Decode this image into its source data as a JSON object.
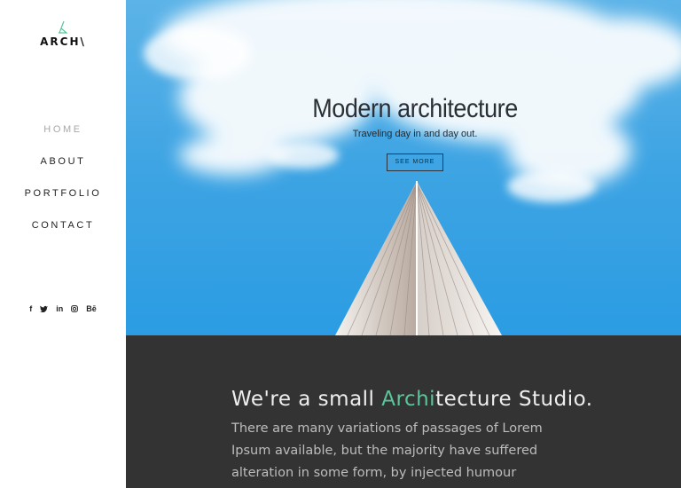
{
  "brand": {
    "name": "ARCH\\",
    "accent_color": "#5bc59a"
  },
  "nav": [
    {
      "label": "HOME",
      "active": true
    },
    {
      "label": "ABOUT",
      "active": false
    },
    {
      "label": "PORTFOLIO",
      "active": false
    },
    {
      "label": "CONTACT",
      "active": false
    }
  ],
  "social": [
    {
      "icon": "facebook-icon",
      "glyph": "f"
    },
    {
      "icon": "twitter-icon",
      "glyph": "t"
    },
    {
      "icon": "linkedin-icon",
      "glyph": "in"
    },
    {
      "icon": "instagram-icon",
      "glyph": ""
    },
    {
      "icon": "behance-icon",
      "glyph": "Bē"
    }
  ],
  "hero": {
    "title": "Modern architecture",
    "subtitle": "Traveling day in and day out.",
    "button_label": "SEE MORE"
  },
  "studio": {
    "title_prefix": "We're a small ",
    "title_accent": "Archi",
    "title_suffix": "tecture Studio.",
    "text": "There are many variations of passages of Lorem Ipsum available, but the majority have suffered alteration in some form, by injected humour"
  }
}
